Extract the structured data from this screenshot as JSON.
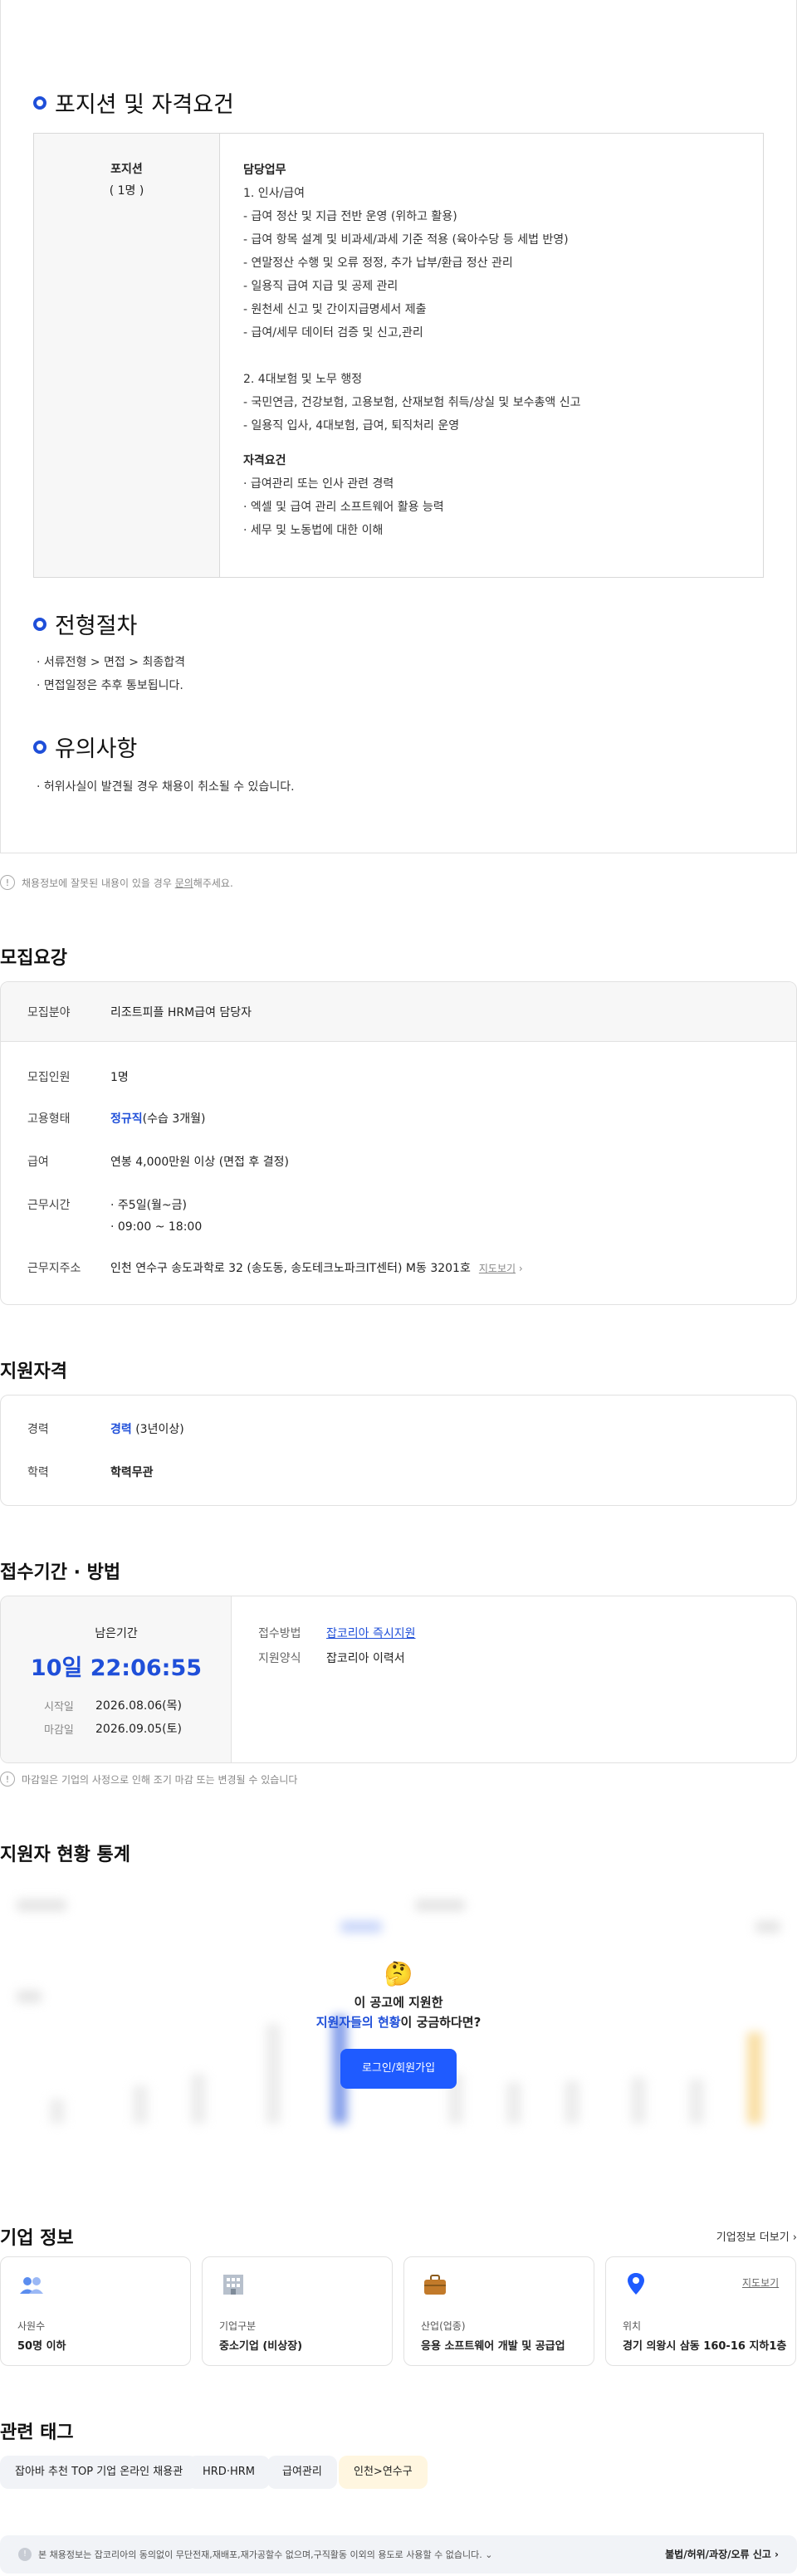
{
  "position": {
    "title": "포지션 및 자격요건",
    "side_title": "포지션",
    "side_count": "( 1명 )",
    "duty_heading": "담당업무",
    "duty_lines": [
      "1. 인사/급여",
      "- 급여 정산 및 지급 전반 운영 (위하고 활용)",
      "- 급여 항목 설계 및 비과세/과세 기준 적용 (육아수당 등 세법 반영)",
      "- 연말정산 수행 및 오류 정정, 추가 납부/환급 정산 관리",
      "- 일용직 급여 지급 및 공제 관리",
      "- 원천세 신고 및 간이지급명세서 제출",
      "- 급여/세무 데이터 검증 및 신고,관리",
      "",
      "2. 4대보험 및 노무 행정",
      "- 국민연금, 건강보험, 고용보험, 산재보험 취득/상실 및 보수총액 신고",
      "- 일용직 입사, 4대보험, 급여, 퇴직처리 운영"
    ],
    "qual_heading": "자격요건",
    "qual_lines": [
      "· 급여관리 또는 인사 관련 경력",
      "· 엑셀 및 급여 관리 소프트웨어 활용 능력",
      "· 세무 및 노동법에 대한 이해"
    ]
  },
  "process": {
    "title": "전형절차",
    "lines": [
      "· 서류전형 > 면접 > 최종합격",
      "· 면접일정은 추후 통보됩니다."
    ]
  },
  "notice": {
    "title": "유의사항",
    "lines": [
      "· 허위사실이 발견될 경우 채용이 취소될 수 있습니다."
    ]
  },
  "report": {
    "text_pre": "채용정보에 잘못된 내용이 있을 경우 ",
    "link": "문의",
    "text_post": "해주세요."
  },
  "recruit": {
    "title": "모집요강",
    "field_label": "모집분야",
    "field_value": "리조트피플 HRM급여 담당자",
    "count_label": "모집인원",
    "count_value": "1명",
    "type_label": "고용형태",
    "type_value": "정규직",
    "type_extra": "(수습 3개월)",
    "salary_label": "급여",
    "salary_value": "연봉 4,000만원 이상 (면접 후 결정)",
    "hours_label": "근무시간",
    "hours_lines": [
      "· 주5일(월~금)",
      "· 09:00 ~ 18:00"
    ],
    "addr_label": "근무지주소",
    "addr_value": "인천 연수구 송도과학로 32 (송도동, 송도테크노파크IT센터) M동 3201호",
    "map_link": "지도보기"
  },
  "qualification": {
    "title": "지원자격",
    "career_label": "경력",
    "career_value": "경력",
    "career_extra": "(3년이상)",
    "edu_label": "학력",
    "edu_value": "학력무관"
  },
  "apply": {
    "title": "접수기간 · 방법",
    "remain_label": "남은기간",
    "remain_value": "10일 22:06:55",
    "start_label": "시작일",
    "start_value": "2026.08.06(목)",
    "end_label": "마감일",
    "end_value": "2026.09.05(토)",
    "method_label": "접수방법",
    "method_value": "잡코리아 즉시지원",
    "form_label": "지원양식",
    "form_value": "잡코리아 이력서",
    "note": "마감일은 기업의 사정으로 인해 조기 마감 또는 변경될 수 있습니다"
  },
  "stats": {
    "title": "지원자 현황 통계",
    "prompt_line1": "이 공고에 지원한",
    "prompt_highlight": "지원자들의 현황",
    "prompt_line2_rest": "이 궁금하다면?",
    "login_button": "로그인/회원가입",
    "emoji": "🤔"
  },
  "company": {
    "title": "기업 정보",
    "more_link": "기업정보 더보기",
    "cards": [
      {
        "icon": "people-icon",
        "label": "사원수",
        "value": "50명 이하"
      },
      {
        "icon": "building-icon",
        "label": "기업구분",
        "value": "중소기업 (비상장)"
      },
      {
        "icon": "briefcase-icon",
        "label": "산업(업종)",
        "value": "응용 소프트웨어 개발 및 공급업"
      },
      {
        "icon": "location-icon",
        "label": "위치",
        "value": "경기 의왕시 삼동 160-16 지하1층",
        "link": "지도보기"
      }
    ]
  },
  "tags": {
    "title": "관련 태그",
    "items": [
      "잡아바 추천 TOP 기업 온라인 채용관",
      "HRD·HRM",
      "급여관리",
      "인천>연수구"
    ]
  },
  "footer": {
    "text": "본 채용정보는 잡코리아의 동의없이 무단전재,재배포,재가공할수 없으며,구직활동 이외의 용도로 사용할 수 없습니다.",
    "report": "불법/허위/과장/오류 신고"
  },
  "colors": {
    "accent": "#1f4fd9",
    "tag_yellow": "#fff6e0"
  }
}
